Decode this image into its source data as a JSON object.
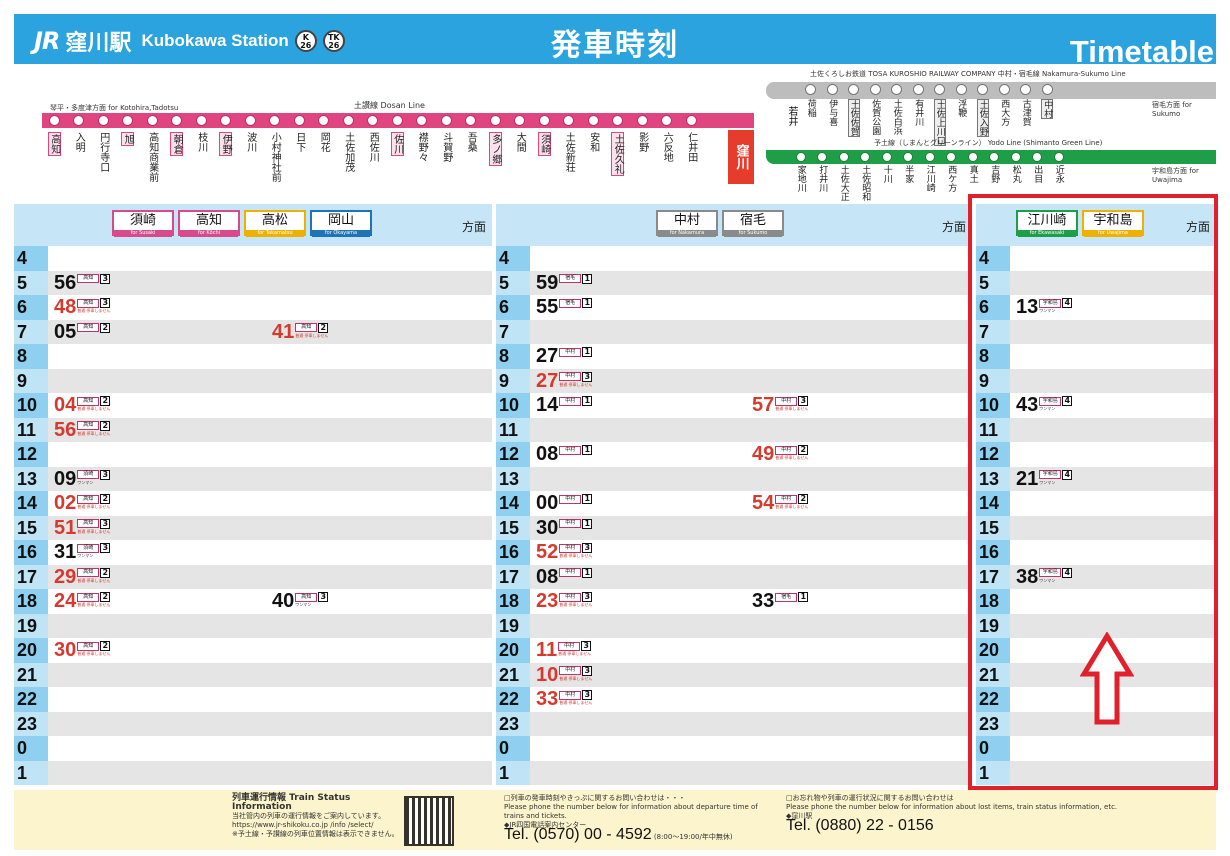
{
  "header": {
    "jr": "JR",
    "station_jp": "窪川駅",
    "station_en": "Kubokawa Station",
    "code1_top": "K",
    "code1_num": "26",
    "code2_top": "TK",
    "code2_num": "26",
    "title": "発車時刻",
    "title_en": "Timetable"
  },
  "routemap": {
    "dosan_caption": "琴平・多度津方面  for Kotohira,Tadotsu",
    "dosan_name": "土讃線  Dosan Line",
    "stations": [
      {
        "name": "高知",
        "boxed": true
      },
      {
        "name": "入明",
        "boxed": false
      },
      {
        "name": "円行寺口",
        "boxed": false
      },
      {
        "name": "旭",
        "boxed": true
      },
      {
        "name": "高知商業前",
        "boxed": false
      },
      {
        "name": "朝倉",
        "boxed": true
      },
      {
        "name": "枝川",
        "boxed": false
      },
      {
        "name": "伊野",
        "boxed": true
      },
      {
        "name": "波川",
        "boxed": false
      },
      {
        "name": "小村神社前",
        "boxed": false
      },
      {
        "name": "日下",
        "boxed": false
      },
      {
        "name": "岡花",
        "boxed": false
      },
      {
        "name": "土佐加茂",
        "boxed": false
      },
      {
        "name": "西佐川",
        "boxed": false
      },
      {
        "name": "佐川",
        "boxed": true
      },
      {
        "name": "襟野々",
        "boxed": false
      },
      {
        "name": "斗賀野",
        "boxed": false
      },
      {
        "name": "吾桑",
        "boxed": false
      },
      {
        "name": "多ノ郷",
        "boxed": true
      },
      {
        "name": "大間",
        "boxed": false
      },
      {
        "name": "須崎",
        "boxed": true
      },
      {
        "name": "土佐新荘",
        "boxed": false
      },
      {
        "name": "安和",
        "boxed": false
      },
      {
        "name": "土佐久礼",
        "boxed": true
      },
      {
        "name": "影野",
        "boxed": false
      },
      {
        "name": "六反地",
        "boxed": false
      },
      {
        "name": "仁井田",
        "boxed": false
      }
    ],
    "kubokawa": "窪川",
    "tosa_caption": "土佐くろしお鉄道  TOSA KUROSHIO RAILWAY COMPANY  中村・宿毛線  Nakamura-Sukumo Line",
    "wakai": "若井",
    "gray_stations": [
      {
        "name": "荷稲",
        "boxed": false
      },
      {
        "name": "伊与喜",
        "boxed": false
      },
      {
        "name": "土佐佐賀",
        "boxed": true
      },
      {
        "name": "佐賀公園",
        "boxed": false
      },
      {
        "name": "土佐白浜",
        "boxed": false
      },
      {
        "name": "有井川",
        "boxed": false
      },
      {
        "name": "土佐上川口",
        "boxed": true
      },
      {
        "name": "浮鞭",
        "boxed": false
      },
      {
        "name": "土佐入野",
        "boxed": true
      },
      {
        "name": "西大方",
        "boxed": false
      },
      {
        "name": "古津賀",
        "boxed": false
      },
      {
        "name": "中村",
        "boxed": true
      }
    ],
    "for_sukumo": "宿毛方面 for Sukumo",
    "yodo_caption": "予土線（しまんとグリーンライン） Yodo Line (Shimanto Green Line)",
    "green_stations": [
      {
        "name": "家地川"
      },
      {
        "name": "打井川"
      },
      {
        "name": "土佐大正"
      },
      {
        "name": "土佐昭和"
      },
      {
        "name": "十川"
      },
      {
        "name": "半家"
      },
      {
        "name": "江川崎"
      },
      {
        "name": "西ケ方"
      },
      {
        "name": "真土"
      },
      {
        "name": "吉野"
      },
      {
        "name": "松丸"
      },
      {
        "name": "出目"
      },
      {
        "name": "近永"
      }
    ],
    "for_uwajima": "宇和島方面 for Uwajima"
  },
  "columns": [
    {
      "dests": [
        {
          "jp": "須崎",
          "en": "for Susaki",
          "color": "#d84a8b"
        },
        {
          "jp": "高知",
          "en": "for Kōchi",
          "color": "#d84a8b"
        },
        {
          "jp": "高松",
          "en": "for Takamatsu",
          "color": "#f0b000"
        },
        {
          "jp": "岡山",
          "en": "for Okayama",
          "color": "#1f74b8"
        }
      ],
      "houmen": "方面",
      "hours": [
        "4",
        "5",
        "6",
        "7",
        "8",
        "9",
        "10",
        "11",
        "12",
        "13",
        "14",
        "15",
        "16",
        "17",
        "18",
        "19",
        "20",
        "21",
        "22",
        "23",
        "0",
        "1"
      ],
      "departures": [
        {
          "row": 1,
          "slot": 0,
          "min": "56",
          "red": false,
          "dest": "高知",
          "car": "3",
          "note": ""
        },
        {
          "row": 2,
          "slot": 0,
          "min": "48",
          "red": true,
          "dest": "高知",
          "car": "3",
          "note": "普通 停車しません"
        },
        {
          "row": 3,
          "slot": 0,
          "min": "05",
          "red": false,
          "dest": "高知",
          "car": "2",
          "note": ""
        },
        {
          "row": 3,
          "slot": 1,
          "min": "41",
          "red": true,
          "dest": "高知",
          "car": "2",
          "note": "普通 停車しません"
        },
        {
          "row": 6,
          "slot": 0,
          "min": "04",
          "red": true,
          "dest": "高知",
          "car": "2",
          "note": "普通 停車しません"
        },
        {
          "row": 7,
          "slot": 0,
          "min": "56",
          "red": true,
          "dest": "高知",
          "car": "2",
          "note": "普通 停車しません"
        },
        {
          "row": 9,
          "slot": 0,
          "min": "09",
          "red": false,
          "dest": "須崎",
          "car": "3",
          "note": "ワンマン"
        },
        {
          "row": 10,
          "slot": 0,
          "min": "02",
          "red": true,
          "dest": "高知",
          "car": "2",
          "note": "普通 停車しません"
        },
        {
          "row": 11,
          "slot": 0,
          "min": "51",
          "red": true,
          "dest": "高知",
          "car": "3",
          "note": "普通 停車しません"
        },
        {
          "row": 12,
          "slot": 0,
          "min": "31",
          "red": false,
          "dest": "須崎",
          "car": "3",
          "note": "ワンマン"
        },
        {
          "row": 13,
          "slot": 0,
          "min": "29",
          "red": true,
          "dest": "高知",
          "car": "2",
          "note": "普通 停車しません"
        },
        {
          "row": 14,
          "slot": 0,
          "min": "24",
          "red": true,
          "dest": "高知",
          "car": "2",
          "note": "普通 停車しません"
        },
        {
          "row": 14,
          "slot": 1,
          "min": "40",
          "red": false,
          "dest": "高知",
          "car": "3",
          "note": "ワンマン"
        },
        {
          "row": 16,
          "slot": 0,
          "min": "30",
          "red": true,
          "dest": "高知",
          "car": "2",
          "note": "普通 停車しません"
        }
      ]
    },
    {
      "dests": [
        {
          "jp": "中村",
          "en": "for Nakamura",
          "color": "#8a8a8a"
        },
        {
          "jp": "宿毛",
          "en": "for Sukumo",
          "color": "#8a8a8a"
        }
      ],
      "houmen": "方面",
      "hours": [
        "4",
        "5",
        "6",
        "7",
        "8",
        "9",
        "10",
        "11",
        "12",
        "13",
        "14",
        "15",
        "16",
        "17",
        "18",
        "19",
        "20",
        "21",
        "22",
        "23",
        "0",
        "1"
      ],
      "departures": [
        {
          "row": 1,
          "slot": 0,
          "min": "59",
          "red": false,
          "dest": "宿毛",
          "car": "1",
          "note": ""
        },
        {
          "row": 2,
          "slot": 0,
          "min": "55",
          "red": false,
          "dest": "宿毛",
          "car": "1",
          "note": ""
        },
        {
          "row": 4,
          "slot": 0,
          "min": "27",
          "red": false,
          "dest": "中村",
          "car": "1",
          "note": ""
        },
        {
          "row": 5,
          "slot": 0,
          "min": "27",
          "red": true,
          "dest": "中村",
          "car": "3",
          "note": "普通 停車しません"
        },
        {
          "row": 6,
          "slot": 0,
          "min": "14",
          "red": false,
          "dest": "中村",
          "car": "1",
          "note": ""
        },
        {
          "row": 6,
          "slot": 1,
          "min": "57",
          "red": true,
          "dest": "中村",
          "car": "3",
          "note": "普通 停車しません"
        },
        {
          "row": 8,
          "slot": 0,
          "min": "08",
          "red": false,
          "dest": "中村",
          "car": "1",
          "note": ""
        },
        {
          "row": 8,
          "slot": 1,
          "min": "49",
          "red": true,
          "dest": "中村",
          "car": "2",
          "note": "普通 停車しません"
        },
        {
          "row": 10,
          "slot": 0,
          "min": "00",
          "red": false,
          "dest": "中村",
          "car": "1",
          "note": ""
        },
        {
          "row": 10,
          "slot": 1,
          "min": "54",
          "red": true,
          "dest": "中村",
          "car": "2",
          "note": "普通 停車しません"
        },
        {
          "row": 11,
          "slot": 0,
          "min": "30",
          "red": false,
          "dest": "中村",
          "car": "1",
          "note": ""
        },
        {
          "row": 12,
          "slot": 0,
          "min": "52",
          "red": true,
          "dest": "中村",
          "car": "3",
          "note": "普通 停車しません"
        },
        {
          "row": 13,
          "slot": 0,
          "min": "08",
          "red": false,
          "dest": "中村",
          "car": "1",
          "note": ""
        },
        {
          "row": 14,
          "slot": 0,
          "min": "23",
          "red": true,
          "dest": "中村",
          "car": "3",
          "note": "普通 停車しません"
        },
        {
          "row": 14,
          "slot": 1,
          "min": "33",
          "red": false,
          "dest": "宿毛",
          "car": "1",
          "note": ""
        },
        {
          "row": 16,
          "slot": 0,
          "min": "11",
          "red": true,
          "dest": "中村",
          "car": "3",
          "note": "普通 停車しません"
        },
        {
          "row": 17,
          "slot": 0,
          "min": "10",
          "red": true,
          "dest": "中村",
          "car": "3",
          "note": "普通 停車しません"
        },
        {
          "row": 18,
          "slot": 0,
          "min": "33",
          "red": true,
          "dest": "中村",
          "car": "3",
          "note": "普通 停車しません"
        }
      ]
    },
    {
      "dests": [
        {
          "jp": "江川崎",
          "en": "for Ekawasaki",
          "color": "#1f9e48"
        },
        {
          "jp": "宇和島",
          "en": "for Uwajima",
          "color": "#f0b000"
        }
      ],
      "houmen": "方面",
      "hours": [
        "4",
        "5",
        "6",
        "7",
        "8",
        "9",
        "10",
        "11",
        "12",
        "13",
        "14",
        "15",
        "16",
        "17",
        "18",
        "19",
        "20",
        "21",
        "22",
        "23",
        "0",
        "1"
      ],
      "departures": [
        {
          "row": 2,
          "slot": 0,
          "min": "13",
          "red": false,
          "dest": "宇和島",
          "car": "4",
          "note": "ワンマン"
        },
        {
          "row": 6,
          "slot": 0,
          "min": "43",
          "red": false,
          "dest": "宇和島",
          "car": "4",
          "note": "ワンマン"
        },
        {
          "row": 9,
          "slot": 0,
          "min": "21",
          "red": false,
          "dest": "宇和島",
          "car": "4",
          "note": "ワンマン"
        },
        {
          "row": 13,
          "slot": 0,
          "min": "38",
          "red": false,
          "dest": "宇和島",
          "car": "4",
          "note": "ワンマン"
        }
      ]
    }
  ],
  "footer": {
    "status_title": "列車運行情報  Train Status Information",
    "status_sub": "当社管内の列車の運行情報をご案内しています。",
    "status_url": "https://www.jr-shikoku.co.jp /info /select/",
    "status_note": "※予土線・予讃線の列車位置情報は表示できません。",
    "inquiry_title": "□列車の発車時刻やきっぷに関するお問い合わせは・・・",
    "inquiry_en": "Please phone the number below for information about departure time of trains and tickets.",
    "inquiry_center": "◆JR四国電話案内センター",
    "inquiry_tel": "Tel. (0570) 00 - 4592",
    "inquiry_hours": "(8:00〜19:00/年中無休)",
    "lost_title": "□お忘れ物や列車の運行状況に関するお問い合わせは",
    "lost_en": "Please phone the number below for information about lost items, train status information, etc.",
    "lost_station": "◆窪川駅",
    "lost_tel": "Tel. (0880) 22 - 0156"
  }
}
